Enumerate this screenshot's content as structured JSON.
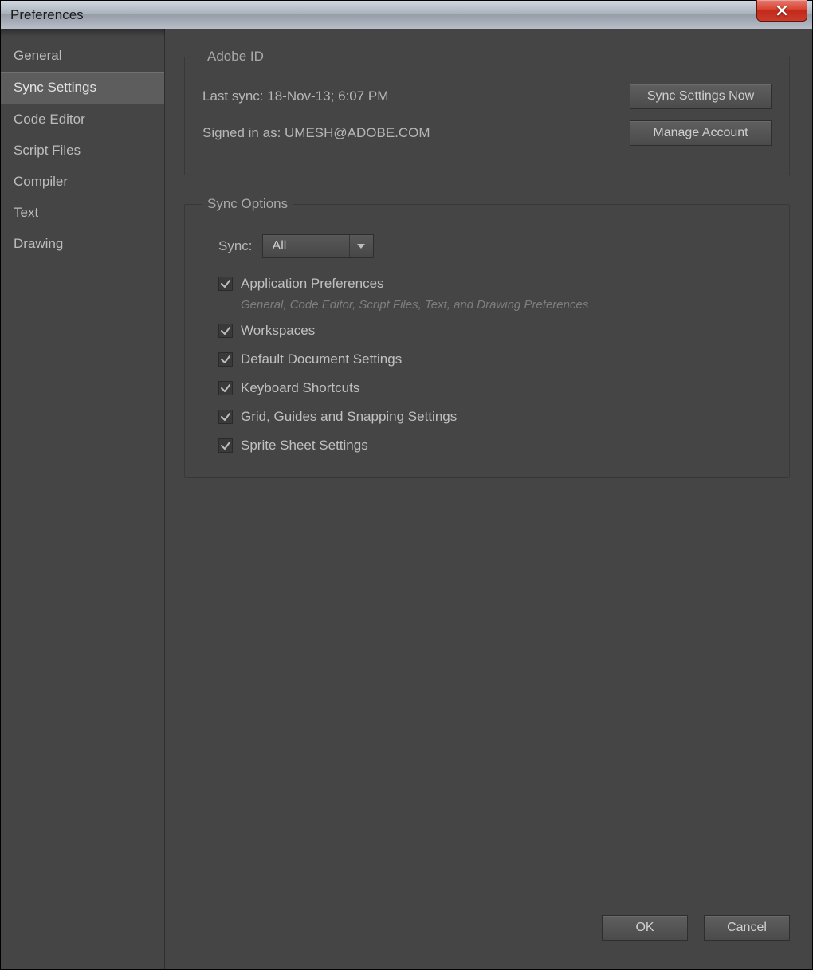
{
  "window": {
    "title": "Preferences"
  },
  "sidebar": {
    "items": [
      {
        "label": "General"
      },
      {
        "label": "Sync Settings"
      },
      {
        "label": "Code Editor"
      },
      {
        "label": "Script Files"
      },
      {
        "label": "Compiler"
      },
      {
        "label": "Text"
      },
      {
        "label": "Drawing"
      }
    ],
    "selected_index": 1
  },
  "adobe_id": {
    "legend": "Adobe ID",
    "last_sync_label": "Last sync: 18-Nov-13; 6:07 PM",
    "signed_in_label": "Signed in as: UMESH@ADOBE.COM",
    "sync_now_button": "Sync Settings Now",
    "manage_account_button": "Manage Account"
  },
  "sync_options": {
    "legend": "Sync Options",
    "sync_label": "Sync:",
    "sync_value": "All",
    "items": [
      {
        "label": "Application Preferences",
        "sub": "General, Code Editor, Script Files, Text, and Drawing Preferences",
        "checked": true
      },
      {
        "label": "Workspaces",
        "checked": true
      },
      {
        "label": "Default Document Settings",
        "checked": true
      },
      {
        "label": "Keyboard Shortcuts",
        "checked": true
      },
      {
        "label": "Grid, Guides and Snapping Settings",
        "checked": true
      },
      {
        "label": "Sprite Sheet Settings",
        "checked": true
      }
    ]
  },
  "footer": {
    "ok": "OK",
    "cancel": "Cancel"
  }
}
